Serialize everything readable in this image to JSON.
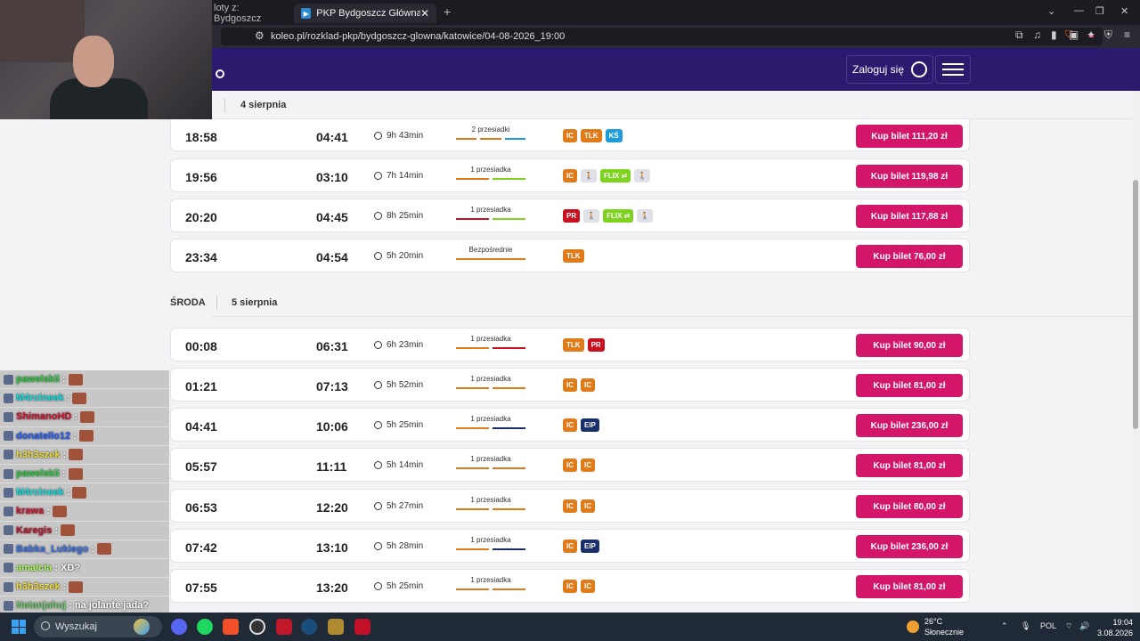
{
  "browser": {
    "tabs": [
      {
        "title": "loty z: Bydgoszcz",
        "active": false
      },
      {
        "title": "PKP Bydgoszcz Główna > Katow",
        "active": true
      }
    ],
    "url": "koleo.pl/rozklad-pkp/bydgoszcz-glowna/katowice/04-08-2026_19:00",
    "shield_count": "1"
  },
  "site": {
    "login_label": "Zaloguj się"
  },
  "days": [
    {
      "dayname": "",
      "date": "4 sierpnia"
    },
    {
      "dayname": "ŚRODA",
      "date": "5 sierpnia"
    }
  ],
  "colors": {
    "IC": "#e07b1a",
    "TLK": "#e07b1a",
    "KŚ": "#1e9cd7",
    "PR": "#c8101e",
    "FLIX": "#7ed321",
    "EIP": "#1a2f6b",
    "walk": "#e0e0e8",
    "buy": "#d4166b",
    "header": "#2b1a6e"
  },
  "connections_day1": [
    {
      "dep": "18:58",
      "arr": "04:41",
      "dur": "9h 43min",
      "transfer": "2 przesiadki",
      "badges": [
        "IC",
        "TLK",
        "KŚ"
      ],
      "price": "Kup bilet 111,20 zł"
    },
    {
      "dep": "19:56",
      "arr": "03:10",
      "dur": "7h 14min",
      "transfer": "1 przesiadka",
      "badges": [
        "IC",
        "walk",
        "FLIX",
        "walk"
      ],
      "price": "Kup bilet 119,98 zł"
    },
    {
      "dep": "20:20",
      "arr": "04:45",
      "dur": "8h 25min",
      "transfer": "1 przesiadka",
      "badges": [
        "PR",
        "walk",
        "FLIX",
        "walk"
      ],
      "price": "Kup bilet 117,88 zł"
    },
    {
      "dep": "23:34",
      "arr": "04:54",
      "dur": "5h 20min",
      "transfer": "Bezpośrednie",
      "badges": [
        "TLK"
      ],
      "price": "Kup bilet 76,00 zł"
    }
  ],
  "connections_day2": [
    {
      "dep": "00:08",
      "arr": "06:31",
      "dur": "6h 23min",
      "transfer": "1 przesiadka",
      "badges": [
        "TLK",
        "PR"
      ],
      "price": "Kup bilet 90,00 zł"
    },
    {
      "dep": "01:21",
      "arr": "07:13",
      "dur": "5h 52min",
      "transfer": "1 przesiadka",
      "badges": [
        "IC",
        "IC"
      ],
      "price": "Kup bilet 81,00 zł"
    },
    {
      "dep": "04:41",
      "arr": "10:06",
      "dur": "5h 25min",
      "transfer": "1 przesiadka",
      "badges": [
        "IC",
        "EIP"
      ],
      "price": "Kup bilet 236,00 zł"
    },
    {
      "dep": "05:57",
      "arr": "11:11",
      "dur": "5h 14min",
      "transfer": "1 przesiadka",
      "badges": [
        "IC",
        "IC"
      ],
      "price": "Kup bilet 81,00 zł"
    },
    {
      "dep": "06:53",
      "arr": "12:20",
      "dur": "5h 27min",
      "transfer": "1 przesiadka",
      "badges": [
        "IC",
        "IC"
      ],
      "price": "Kup bilet 80,00 zł"
    },
    {
      "dep": "07:42",
      "arr": "13:10",
      "dur": "5h 28min",
      "transfer": "1 przesiadka",
      "badges": [
        "IC",
        "EIP"
      ],
      "price": "Kup bilet 236,00 zł"
    },
    {
      "dep": "07:55",
      "arr": "13:20",
      "dur": "5h 25min",
      "transfer": "1 przesiadka",
      "badges": [
        "IC",
        "IC"
      ],
      "price": "Kup bilet 81,00 zł"
    }
  ],
  "chat": [
    {
      "user": "pawelskii",
      "color": "#2ecc40",
      "msg": ""
    },
    {
      "user": "M4rcineek",
      "color": "#17e0e0",
      "msg": ""
    },
    {
      "user": "ShimanoHD",
      "color": "#d0102a",
      "msg": ""
    },
    {
      "user": "donatello12",
      "color": "#1e5aff",
      "msg": ""
    },
    {
      "user": "h3h3szek",
      "color": "#f0e040",
      "msg": ""
    },
    {
      "user": "pawelskii",
      "color": "#2ecc40",
      "msg": ""
    },
    {
      "user": "M4rcineek",
      "color": "#17e0e0",
      "msg": ""
    },
    {
      "user": "krawa",
      "color": "#d0102a",
      "msg": ""
    },
    {
      "user": "Karegis",
      "color": "#c0102a",
      "msg": ""
    },
    {
      "user": "Babka_Lukiego",
      "color": "#3a70e0",
      "msg": ""
    },
    {
      "user": "amalcia",
      "color": "#b0ff60",
      "msg": "XD?"
    },
    {
      "user": "h3h3szek",
      "color": "#f0e040",
      "msg": ""
    },
    {
      "user": "Netanjahuj",
      "color": "#6ec96e",
      "msg": "na jolante jada?"
    }
  ],
  "taskbar": {
    "search_placeholder": "Wyszukaj",
    "weather_temp": "26°C",
    "weather_desc": "Słonecznie",
    "lang": "POL",
    "time": "19:04",
    "date": "3.08.2026",
    "weather_badge": "1"
  }
}
